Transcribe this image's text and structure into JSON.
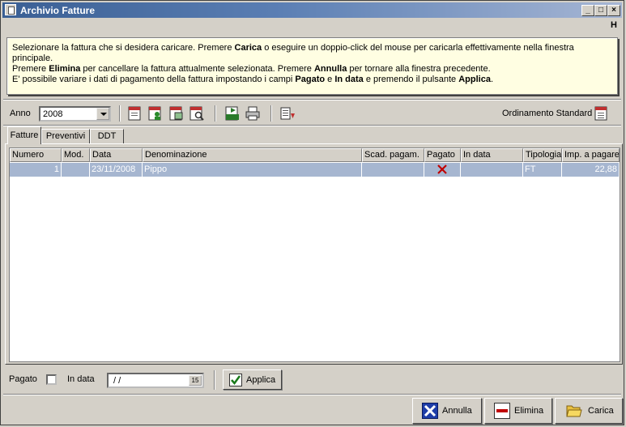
{
  "window": {
    "title": "Archivio Fatture",
    "menu_letter": "H",
    "min": "_",
    "max": "□",
    "close": "×"
  },
  "info": {
    "line1_pre": "Selezionare la fattura che si desidera caricare. Premere ",
    "line1_b1": "Carica",
    "line1_post": " o eseguire un doppio-click del mouse per caricarla effettivamente nella finestra principale.",
    "line2_pre": "Premere ",
    "line2_b1": "Elimina",
    "line2_mid": " per cancellare la fattura attualmente selezionata. Premere ",
    "line2_b2": "Annulla",
    "line2_post": " per tornare alla finestra precedente.",
    "line3_pre": "E' possibile variare i dati di pagamento della fattura impostando i campi ",
    "line3_b1": "Pagato",
    "line3_mid1": " e ",
    "line3_b2": "In data",
    "line3_mid2": " e premendo il pulsante ",
    "line3_b3": "Applica",
    "line3_post": "."
  },
  "toolbar": {
    "anno_label": "Anno",
    "anno_value": "2008",
    "ordinamento_label": "Ordinamento Standard"
  },
  "tabs": [
    {
      "label": "Fatture"
    },
    {
      "label": "Preventivi"
    },
    {
      "label": "DDT"
    }
  ],
  "table": {
    "headers": [
      "Numero",
      "Mod.",
      "Data",
      "Denominazione",
      "Scad. pagam.",
      "Pagato",
      "In data",
      "Tipologia",
      "Imp. a pagare"
    ],
    "rows": [
      {
        "numero": "1",
        "mod": "",
        "data": "23/11/2008",
        "denominazione": "Pippo",
        "scad": "",
        "pagato_icon": "red-x-icon",
        "in_data": "",
        "tipologia": "FT",
        "importo": "22,88"
      }
    ]
  },
  "bottom": {
    "pagato_label": "Pagato",
    "in_data_label": "In data",
    "date_value": " / /",
    "cal_label": "15",
    "applica_label": "Applica"
  },
  "footer": {
    "annulla_label": "Annulla",
    "elimina_label": "Elimina",
    "carica_label": "Carica"
  },
  "colors": {
    "selection": "#a6b6d0",
    "info_bg": "#fffee2",
    "title_grad": "#3a5f94"
  }
}
